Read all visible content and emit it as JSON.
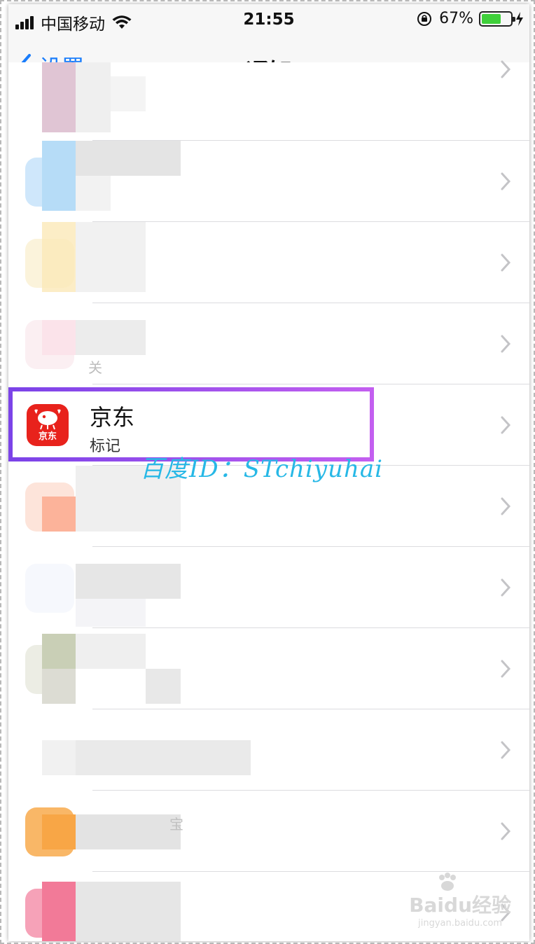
{
  "status_bar": {
    "carrier": "中国移动",
    "time": "21:55",
    "battery_percent": "67%",
    "battery_level": 0.67
  },
  "nav": {
    "back_label": "设置",
    "title": "通知"
  },
  "highlighted_app": {
    "name": "京东",
    "subtitle": "标记",
    "icon_label": "京东",
    "icon_color": "#e8221c"
  },
  "blurred_fragments": {
    "row4": "关",
    "row9": "宝"
  },
  "watermark": {
    "text": "百度ID：STchiyuhai",
    "baidu_text": "Baidu经验",
    "baidu_url": "jingyan.baidu.com"
  },
  "colors": {
    "accent": "#1a7dfb",
    "highlight_border": "#9b51ec",
    "watermark": "#27b8e6"
  }
}
